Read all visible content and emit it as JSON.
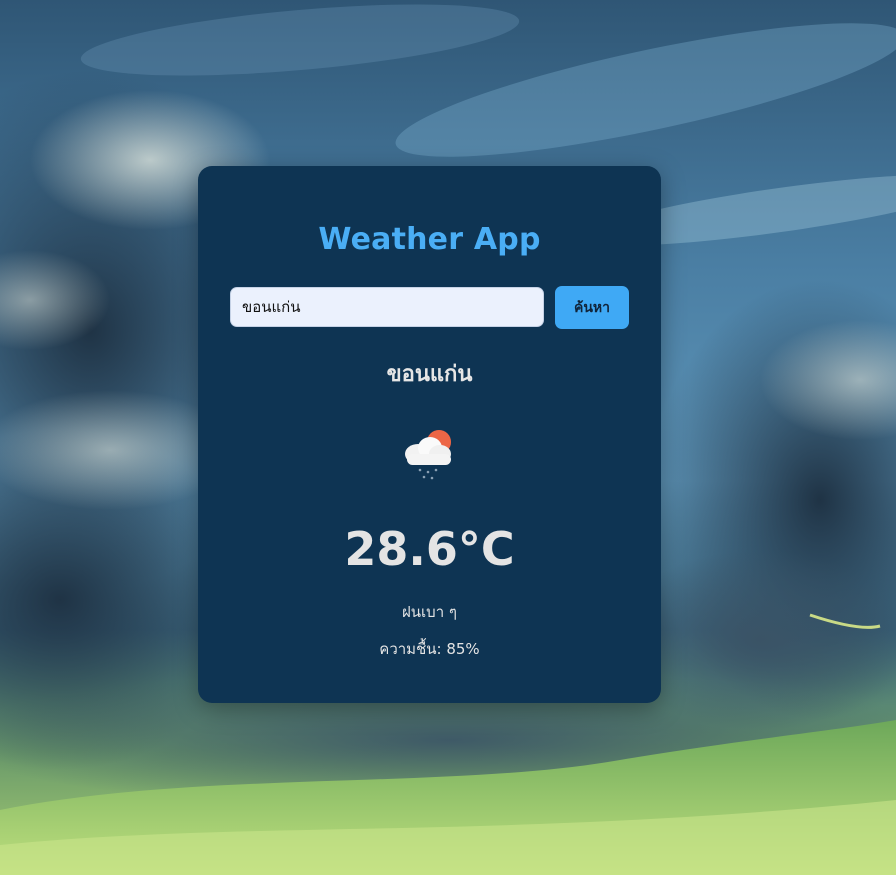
{
  "app": {
    "title": "Weather App"
  },
  "search": {
    "value": "ขอนแก่น",
    "button_label": "ค้นหา"
  },
  "weather": {
    "city": "ขอนแก่น",
    "icon": "cloud-rain-sun-icon",
    "temperature": "28.6°C",
    "description": "ฝนเบา ๆ",
    "humidity_label": "ความชื้น:",
    "humidity_value": "85%"
  },
  "colors": {
    "card_background": "#0e3453",
    "title": "#4aaef5",
    "button": "#3fa9f5",
    "input_background": "#ebf1fd"
  }
}
